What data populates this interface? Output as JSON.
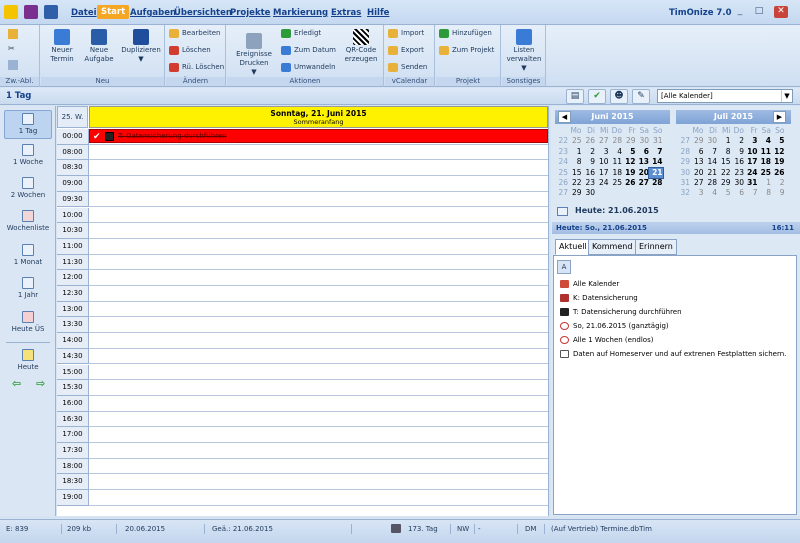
{
  "app": {
    "title": "TimOnize 7.0"
  },
  "menu": [
    "Datei",
    "Start",
    "Aufgaben",
    "Übersichten",
    "Projekte",
    "Markierung",
    "Extras",
    "Hilfe"
  ],
  "ribbon": {
    "groups": [
      "Zw.-Abl.",
      "Neu",
      "Ändern",
      "Aktionen",
      "vCalendar",
      "Projekt",
      "Sonstiges"
    ],
    "neu": {
      "neuer_termin": "Neuer Termin",
      "neue_aufgabe": "Neue Aufgabe",
      "duplizieren": "Duplizieren"
    },
    "aendern": {
      "bearbeiten": "Bearbeiten",
      "loeschen": "Löschen",
      "rue_loeschen": "Rü. Löschen"
    },
    "aktionen": {
      "ereignisse": "Ereignisse Drucken",
      "erledigt": "Erledigt",
      "zum_datum": "Zum Datum",
      "umwandeln": "Umwandeln",
      "qrcode": "QR-Code erzeugen"
    },
    "vcal": {
      "import": "Import",
      "export": "Export",
      "senden": "Senden"
    },
    "projekt": {
      "hinzufuegen": "Hinzufügen",
      "zum_projekt": "Zum Projekt"
    },
    "sonstiges": {
      "listen": "Listen verwalten"
    }
  },
  "view": {
    "title": "1 Tag",
    "calendar_select": "[Alle Kalender]"
  },
  "nav": [
    "1 Tag",
    "1 Woche",
    "2 Wochen",
    "Wochenliste",
    "1 Monat",
    "1 Jahr",
    "Heute ÜS",
    "Heute"
  ],
  "day": {
    "week": "25. W.",
    "date_line": "Sonntag, 21. Juni 2015",
    "holiday": "Sommeranfang",
    "event": "T: Datensicherung durchführen",
    "times": [
      "00:00",
      "08:00",
      "08:30",
      "09:00",
      "09:30",
      "10:00",
      "10:30",
      "11:00",
      "11:30",
      "12:00",
      "12:30",
      "13:00",
      "13:30",
      "14:00",
      "14:30",
      "15:00",
      "15:30",
      "16:00",
      "16:30",
      "17:00",
      "17:30",
      "18:00",
      "18:30",
      "19:00"
    ]
  },
  "minical": {
    "weekday_headers": [
      "Mo",
      "Di",
      "Mi",
      "Do",
      "Fr",
      "Sa",
      "So"
    ],
    "months": [
      {
        "title": "Juni 2015",
        "weeks": [
          [
            "22",
            "25",
            "26",
            "27",
            "28",
            "29",
            "30",
            "31"
          ],
          [
            "23",
            "1",
            "2",
            "3",
            "4",
            "5",
            "6",
            "7"
          ],
          [
            "24",
            "8",
            "9",
            "10",
            "11",
            "12",
            "13",
            "14"
          ],
          [
            "25",
            "15",
            "16",
            "17",
            "18",
            "19",
            "20",
            "21"
          ],
          [
            "26",
            "22",
            "23",
            "24",
            "25",
            "26",
            "27",
            "28"
          ],
          [
            "27",
            "29",
            "30",
            "",
            "",
            "",
            "",
            ""
          ]
        ]
      },
      {
        "title": "Juli 2015",
        "weeks": [
          [
            "27",
            "29",
            "30",
            "1",
            "2",
            "3",
            "4",
            "5"
          ],
          [
            "28",
            "6",
            "7",
            "8",
            "9",
            "10",
            "11",
            "12"
          ],
          [
            "29",
            "13",
            "14",
            "15",
            "16",
            "17",
            "18",
            "19"
          ],
          [
            "30",
            "20",
            "21",
            "22",
            "23",
            "24",
            "25",
            "26"
          ],
          [
            "31",
            "27",
            "28",
            "29",
            "30",
            "31",
            "1",
            "2"
          ],
          [
            "32",
            "3",
            "4",
            "5",
            "6",
            "7",
            "8",
            "9"
          ]
        ]
      }
    ],
    "today_label": "Heute: 21.06.2015"
  },
  "status_line": {
    "left": "Heute: So., 21.06.2015",
    "right": "16:11"
  },
  "tabs": [
    "Aktuell",
    "Kommend",
    "Erinnern"
  ],
  "info_tab": "A",
  "info": [
    "Alle Kalender",
    "K: Datensicherung",
    "T: Datensicherung durchführen",
    "So, 21.06.2015 (ganztägig)",
    "Alle 1 Wochen (endlos)",
    "Daten auf Homeserver und auf extrenen Festplatten sichern."
  ],
  "statusbar": [
    "E: 839",
    "209 kb",
    "20.06.2015",
    "Geä.: 21.06.2015",
    "173. Tag",
    "NW",
    "-",
    "DM",
    "(Auf Vertrieb) Termine.dbTim"
  ]
}
